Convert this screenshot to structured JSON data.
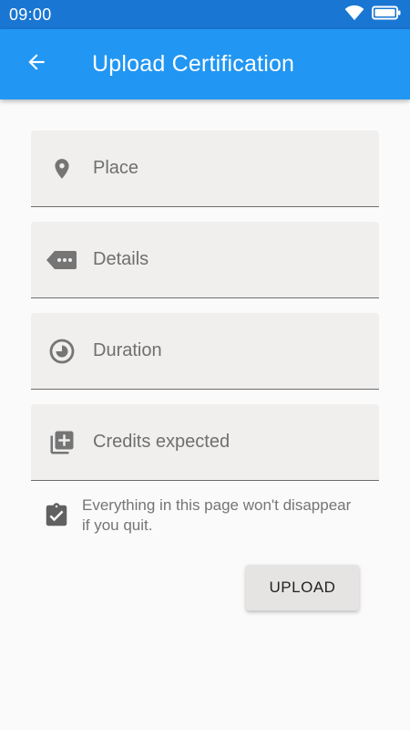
{
  "status_bar": {
    "time": "09:00",
    "icons": [
      "wifi-icon",
      "battery-icon"
    ]
  },
  "app_bar": {
    "title": "Upload Certification",
    "back_icon": "arrow-back-icon",
    "color": "#2196f3"
  },
  "form": {
    "fields": [
      {
        "label": "Place",
        "icon": "location-pin-icon"
      },
      {
        "label": "Details",
        "icon": "label-tag-icon"
      },
      {
        "label": "Duration",
        "icon": "timelapse-icon"
      },
      {
        "label": "Credits expected",
        "icon": "library-add-icon"
      }
    ],
    "note": {
      "text": "Everything in this page won't disappear if you quit.",
      "icon": "clipboard-check-icon"
    },
    "upload_label": "UPLOAD"
  }
}
